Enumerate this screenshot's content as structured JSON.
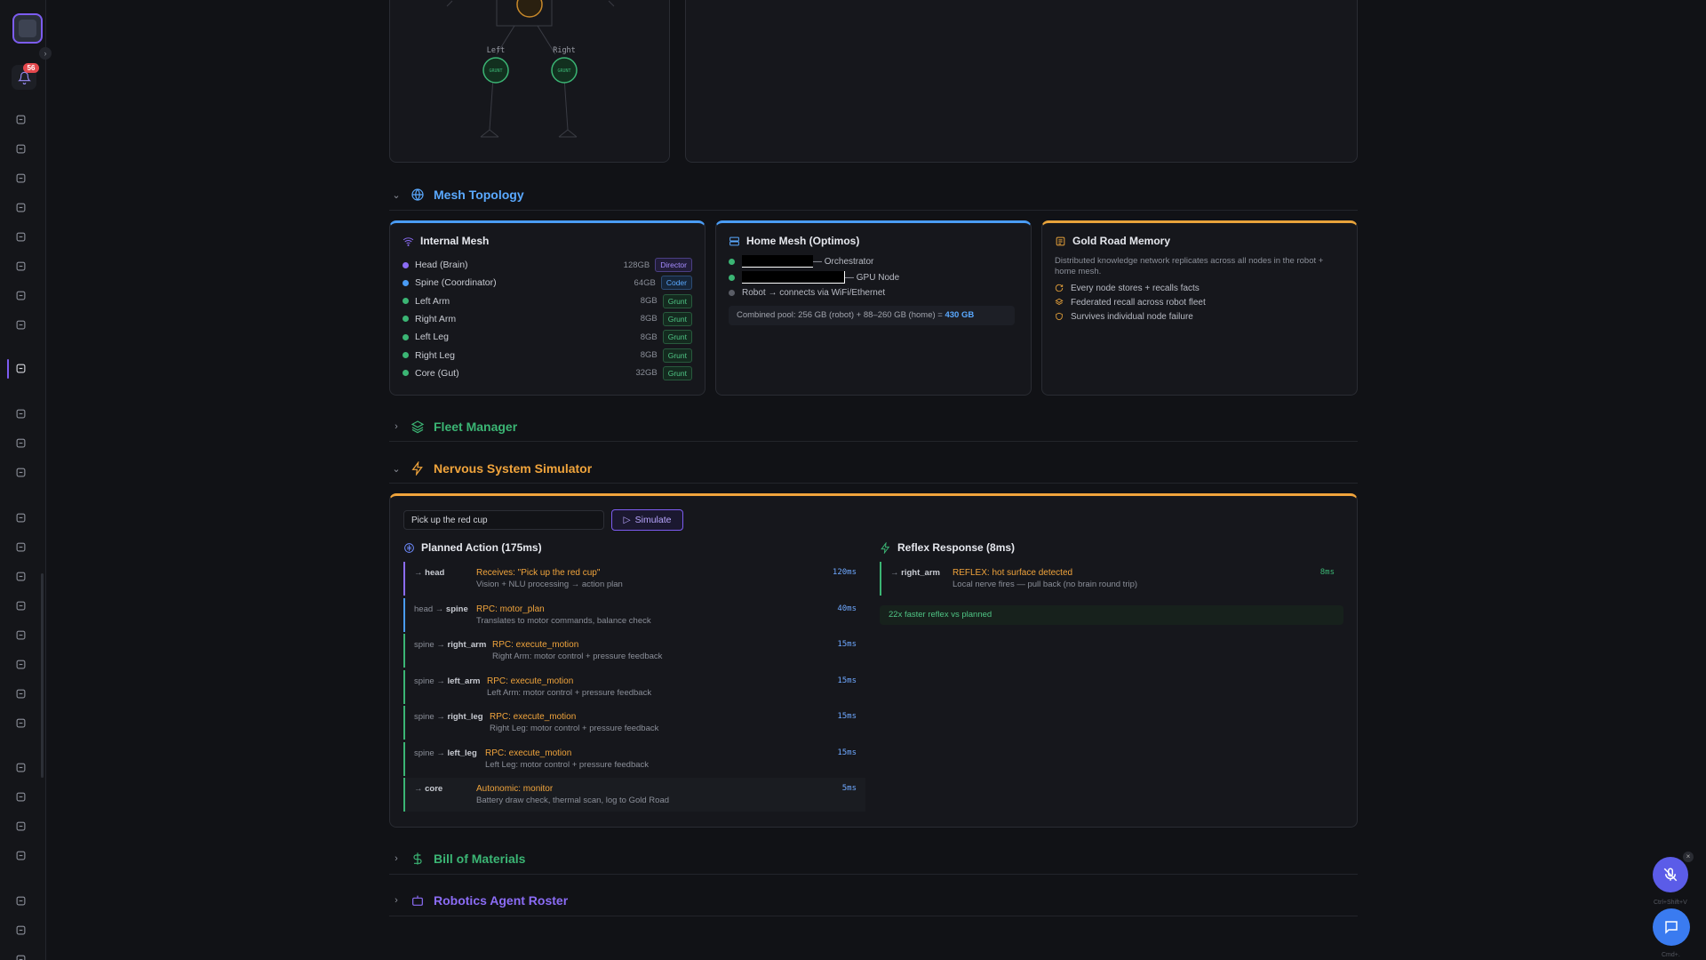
{
  "sidebar": {
    "notification_count": "56",
    "icons": [
      "building-icon",
      "rocket-icon",
      "bolt-icon",
      "globe-icon",
      "globe-alt-icon",
      "users-icon",
      "video-icon",
      "video-alt-icon",
      "robot-icon",
      "shirt-icon",
      "hard-hat-icon",
      "package-icon",
      "car-icon",
      "search-icon",
      "box-icon",
      "wrench-icon",
      "hammer-icon",
      "dollar-icon",
      "palette-icon",
      "trending-icon",
      "scales-icon",
      "hammer-alt-icon",
      "document-icon",
      "bolt-alt-icon",
      "book-icon",
      "refresh-icon",
      "book-alt-icon"
    ]
  },
  "robot_diagram": {
    "left_label": "Left",
    "right_label": "Right",
    "node_label": "GRUNT"
  },
  "sections": {
    "mesh_topology": "Mesh Topology",
    "fleet_manager": "Fleet Manager",
    "nervous_system": "Nervous System Simulator",
    "bill_of_materials": "Bill of Materials",
    "robotics_roster": "Robotics Agent Roster"
  },
  "internal_mesh": {
    "title": "Internal Mesh",
    "nodes": [
      {
        "name": "Head (Brain)",
        "mem": "128GB",
        "role": "Director",
        "color": "#8b6cf5"
      },
      {
        "name": "Spine (Coordinator)",
        "mem": "64GB",
        "role": "Coder",
        "color": "#4a9cf5"
      },
      {
        "name": "Left Arm",
        "mem": "8GB",
        "role": "Grunt",
        "color": "#3bb574"
      },
      {
        "name": "Right Arm",
        "mem": "8GB",
        "role": "Grunt",
        "color": "#3bb574"
      },
      {
        "name": "Left Leg",
        "mem": "8GB",
        "role": "Grunt",
        "color": "#3bb574"
      },
      {
        "name": "Right Leg",
        "mem": "8GB",
        "role": "Grunt",
        "color": "#3bb574"
      },
      {
        "name": "Core (Gut)",
        "mem": "32GB",
        "role": "Grunt",
        "color": "#3bb574"
      }
    ]
  },
  "home_mesh": {
    "title": "Home Mesh (Optimos)",
    "orchestrator_label": "— Orchestrator",
    "gpu_label": "— GPU Node",
    "robot_link": "Robot → connects via WiFi/Ethernet",
    "pool_text": "Combined pool: 256 GB (robot) + 88–260 GB (home) = ",
    "pool_total": "430 GB"
  },
  "gold_road": {
    "title": "Gold Road Memory",
    "description": "Distributed knowledge network replicates across all nodes in the robot + home mesh.",
    "features": [
      "Every node stores + recalls facts",
      "Federated recall across robot fleet",
      "Survives individual node failure"
    ]
  },
  "simulator": {
    "input_value": "Pick up the red cup",
    "simulate_label": "Simulate",
    "planned_title": "Planned Action (175ms)",
    "reflex_title": "Reflex Response (8ms)",
    "steps": [
      {
        "from": "",
        "to": "head",
        "action": "Receives: \"Pick up the red cup\"",
        "detail": "Vision + NLU processing → action plan",
        "ms": "120ms"
      },
      {
        "from": "head",
        "to": "spine",
        "action": "RPC: motor_plan",
        "detail": "Translates to motor commands, balance check",
        "ms": "40ms"
      },
      {
        "from": "spine",
        "to": "right_arm",
        "action": "RPC: execute_motion",
        "detail": "Right Arm: motor control + pressure feedback",
        "ms": "15ms"
      },
      {
        "from": "spine",
        "to": "left_arm",
        "action": "RPC: execute_motion",
        "detail": "Left Arm: motor control + pressure feedback",
        "ms": "15ms"
      },
      {
        "from": "spine",
        "to": "right_leg",
        "action": "RPC: execute_motion",
        "detail": "Right Leg: motor control + pressure feedback",
        "ms": "15ms"
      },
      {
        "from": "spine",
        "to": "left_leg",
        "action": "RPC: execute_motion",
        "detail": "Left Leg: motor control + pressure feedback",
        "ms": "15ms"
      },
      {
        "from": "",
        "to": "core",
        "action": "Autonomic: monitor",
        "detail": "Battery draw check, thermal scan, log to Gold Road",
        "ms": "5ms"
      }
    ],
    "reflex": {
      "to": "right_arm",
      "action": "REFLEX: hot surface detected",
      "detail": "Local nerve fires — pull back (no brain round trip)",
      "ms": "8ms"
    },
    "reflex_note": "22x faster reflex vs planned"
  },
  "floating": {
    "mic_hint": "Ctrl+Shift+V",
    "chat_hint": "Cmd+."
  }
}
